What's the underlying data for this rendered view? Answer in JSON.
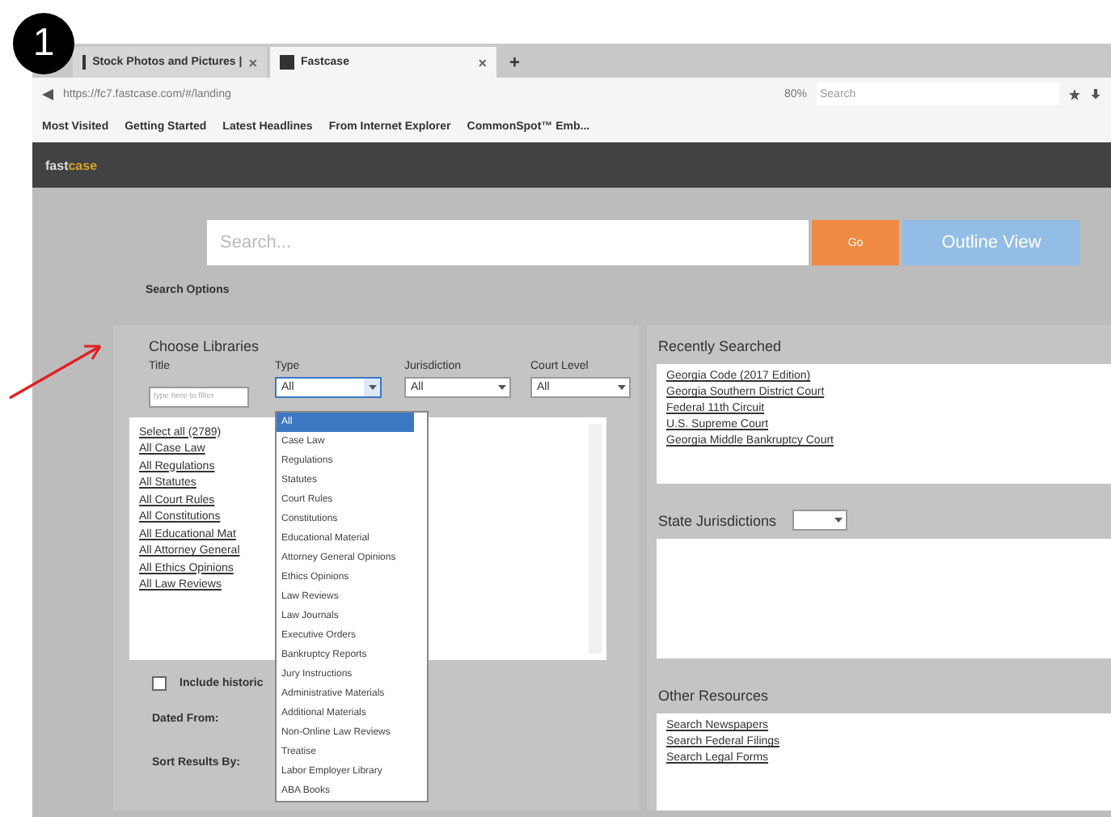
{
  "badge": "1",
  "browser": {
    "tabs": [
      {
        "label": "Stock Photos and Pictures |",
        "close": "×",
        "selected": false
      },
      {
        "label": "Fastcase",
        "close": "×",
        "selected": true
      }
    ],
    "new_tab": "+",
    "url": "https://fc7.fastcase.com/#/landing",
    "zoom": "80%",
    "search": {
      "placeholder": "Search"
    },
    "bookmarks": [
      "Most Visited",
      "Getting Started",
      "Latest Headlines",
      "From Internet Explorer",
      "CommonSpot™ Emb..."
    ]
  },
  "header": {
    "logo": "fast",
    "logo_accent": "case"
  },
  "search": {
    "placeholder": "Search...",
    "go": "Go",
    "outline": "Outline View",
    "options": "Search Options"
  },
  "libraries": {
    "title": "Choose Libraries",
    "filters": [
      {
        "label": "Title",
        "kind": "input",
        "placeholder": "type here to filter"
      },
      {
        "label": "Type",
        "kind": "select",
        "value": "All",
        "open": true
      },
      {
        "label": "Jurisdiction",
        "kind": "select",
        "value": "All",
        "open": false
      },
      {
        "label": "Court Level",
        "kind": "select",
        "value": "All",
        "open": false
      }
    ],
    "links": [
      "Select all (2789)",
      "All Case Law",
      "All Regulations",
      "All Statutes",
      "All Court Rules",
      "All Constitutions",
      "All Educational Mat",
      "All Attorney General",
      "All Ethics Opinions",
      "All Law Reviews"
    ],
    "include": {
      "label": "Include historic",
      "checked": false
    },
    "dated_from": "Dated From:",
    "sort_by": "Sort Results By:",
    "type_options": [
      {
        "label": "All",
        "selected": true
      },
      {
        "label": "Case Law",
        "selected": false
      },
      {
        "label": "Regulations",
        "selected": false
      },
      {
        "label": "Statutes",
        "selected": false
      },
      {
        "label": "Court Rules",
        "selected": false
      },
      {
        "label": "Constitutions",
        "selected": false
      },
      {
        "label": "Educational Material",
        "selected": false
      },
      {
        "label": "Attorney General Opinions",
        "selected": false
      },
      {
        "label": "Ethics Opinions",
        "selected": false
      },
      {
        "label": "Law Reviews",
        "selected": false
      },
      {
        "label": "Law Journals",
        "selected": false
      },
      {
        "label": "Executive Orders",
        "selected": false
      },
      {
        "label": "Bankruptcy Reports",
        "selected": false
      },
      {
        "label": "Jury Instructions",
        "selected": false
      },
      {
        "label": "Administrative Materials",
        "selected": false
      },
      {
        "label": "Additional Materials",
        "selected": false
      },
      {
        "label": "Non-Online Law Reviews",
        "selected": false
      },
      {
        "label": "Treatise",
        "selected": false
      },
      {
        "label": "Labor Employer Library",
        "selected": false
      },
      {
        "label": "ABA Books",
        "selected": false
      }
    ]
  },
  "recent": {
    "title": "Recently Searched",
    "items": [
      "Georgia Code (2017 Edition)",
      "Georgia Southern District Court",
      "Federal 11th Circuit",
      "U.S. Supreme Court",
      "Georgia Middle Bankruptcy Court"
    ]
  },
  "state": {
    "title": "State Jurisdictions"
  },
  "other": {
    "title": "Other Resources",
    "items": [
      "Search Newspapers",
      "Search Federal Filings",
      "Search Legal Forms"
    ]
  }
}
